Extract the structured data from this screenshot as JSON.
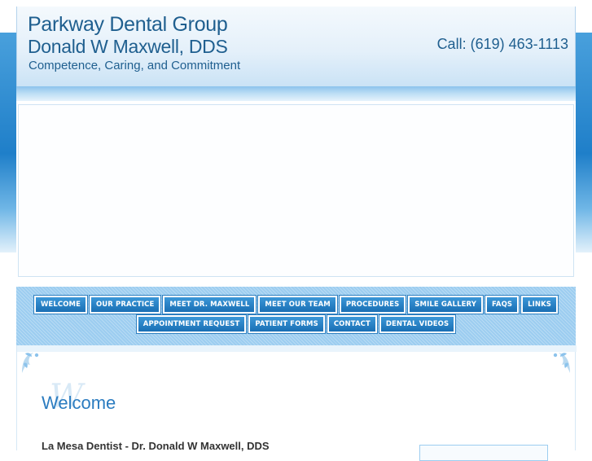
{
  "header": {
    "practice_name": "Parkway Dental Group",
    "doctor": "Donald W Maxwell, DDS",
    "tagline": "Competence, Caring, and Commitment",
    "phone": "Call: (619) 463-1113"
  },
  "nav": {
    "row1": [
      {
        "label": "WELCOME"
      },
      {
        "label": "OUR PRACTICE"
      },
      {
        "label": "MEET DR. MAXWELL"
      },
      {
        "label": "MEET OUR TEAM"
      },
      {
        "label": "PROCEDURES"
      },
      {
        "label": "SMILE GALLERY"
      },
      {
        "label": "FAQS"
      },
      {
        "label": "LINKS"
      }
    ],
    "row2": [
      {
        "label": "APPOINTMENT REQUEST"
      },
      {
        "label": "PATIENT FORMS"
      },
      {
        "label": "CONTACT"
      },
      {
        "label": "DENTAL VIDEOS"
      }
    ]
  },
  "content": {
    "script_watermark": "W",
    "heading": "Welcome",
    "intro_title": "La Mesa Dentist - Dr. Donald W Maxwell, DDS"
  },
  "colors": {
    "brand_text": "#1f5f8f",
    "nav_button": "#1a6fb4",
    "nav_background": "#9ccdf0",
    "heading": "#2b7cc0"
  },
  "icons": {
    "corner_ornament": "floral-corner-icon"
  }
}
